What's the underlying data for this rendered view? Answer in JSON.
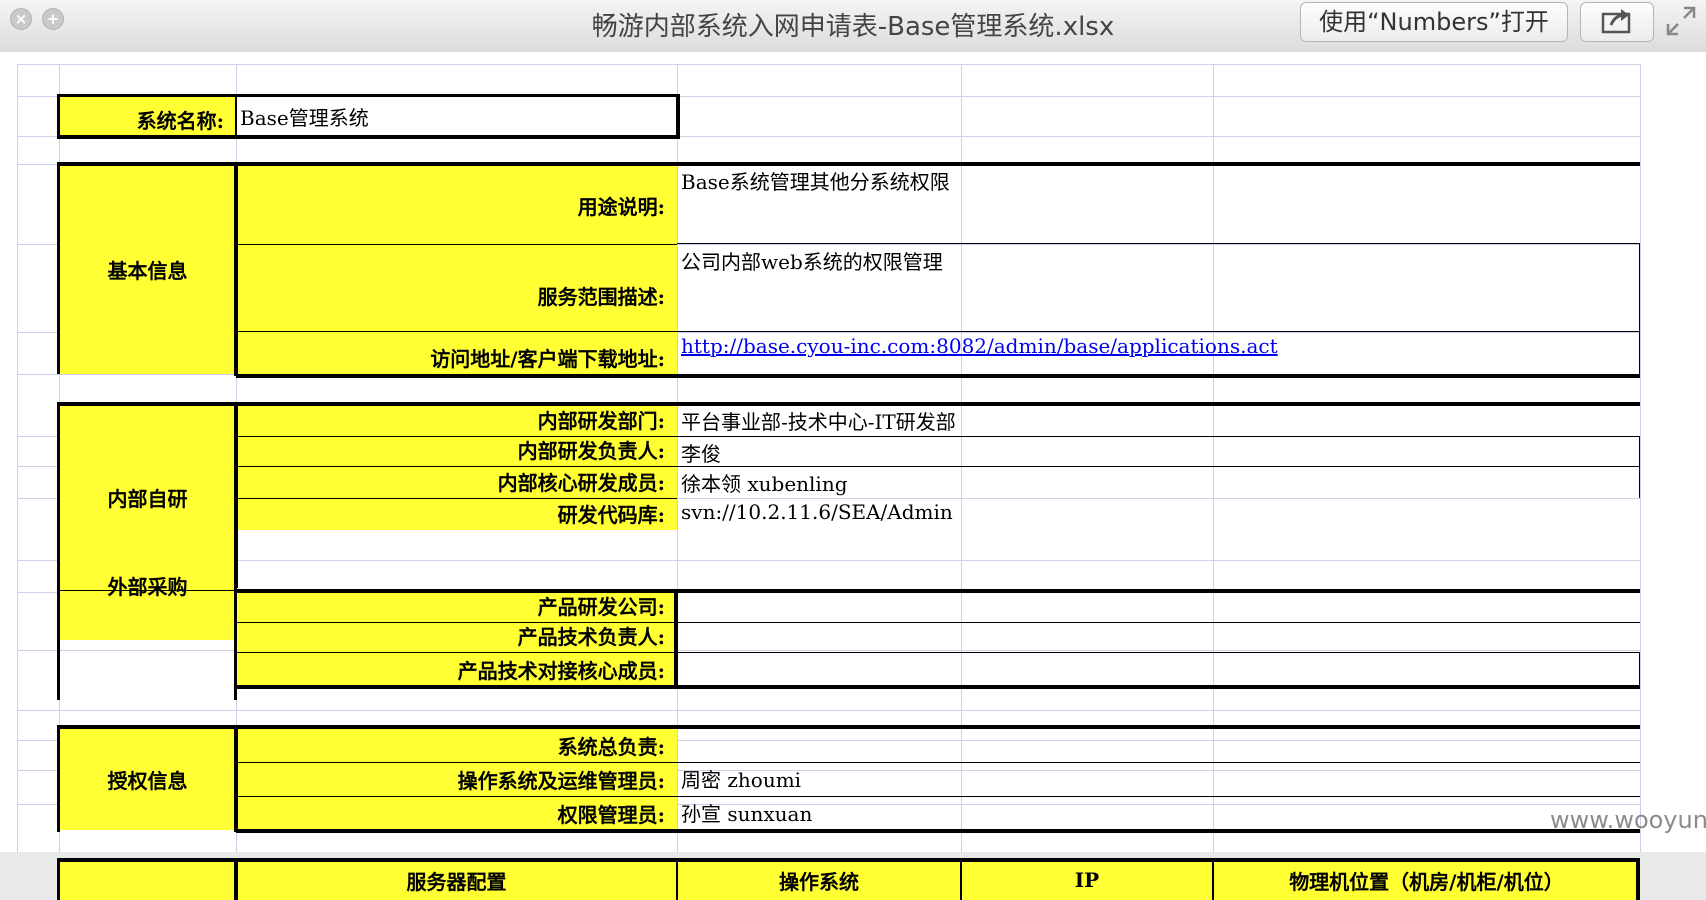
{
  "window": {
    "title": "畅游内部系统入网申请表-Base管理系统.xlsx",
    "open_button": "使用“Numbers”打开",
    "close_glyph": "×",
    "add_glyph": "+",
    "icons": [
      "close-icon",
      "plus-icon",
      "share-icon",
      "fullscreen-icon"
    ]
  },
  "sheet": {
    "system_name": {
      "label": "系统名称:",
      "value": "Base管理系统"
    },
    "basic_info": {
      "group": "基本信息",
      "rows": [
        {
          "label": "用途说明:",
          "value": "Base系统管理其他分系统权限"
        },
        {
          "label": "服务范围描述:",
          "value": "公司内部web系统的权限管理"
        },
        {
          "label": "访问地址/客户端下载地址:",
          "value": "http://base.cyou-inc.com:8082/admin/base/applications.act"
        }
      ]
    },
    "internal_dev": {
      "group": "内部自研",
      "rows": [
        {
          "label": "内部研发部门:",
          "value": "平台事业部-技术中心-IT研发部"
        },
        {
          "label": "内部研发负责人:",
          "value": "李俊"
        },
        {
          "label": "内部核心研发成员:",
          "value": "徐本领 xubenling"
        },
        {
          "label": "研发代码库:",
          "value": "svn://10.2.11.6/SEA/Admin"
        }
      ]
    },
    "external": {
      "group": "外部采购",
      "rows": [
        {
          "label": "产品研发公司:",
          "value": ""
        },
        {
          "label": "产品技术负责人:",
          "value": ""
        },
        {
          "label": "产品技术对接核心成员:",
          "value": ""
        }
      ]
    },
    "auth": {
      "group": "授权信息",
      "rows": [
        {
          "label": "系统总负责:",
          "value": ""
        },
        {
          "label": "操作系统及运维管理员:",
          "value": "周密 zhoumi"
        },
        {
          "label": "权限管理员:",
          "value": "孙宣 sunxuan"
        }
      ]
    },
    "server_header": {
      "col1": "服务器配置",
      "col2": "操作系统",
      "col3": "IP",
      "col4": "物理机位置（机房/机柜/机位）"
    }
  },
  "watermark": "www.wooyun.org",
  "colors": {
    "label_fill": "#ffff33",
    "link": "#0000ee",
    "grid": "#cfcfe8"
  }
}
